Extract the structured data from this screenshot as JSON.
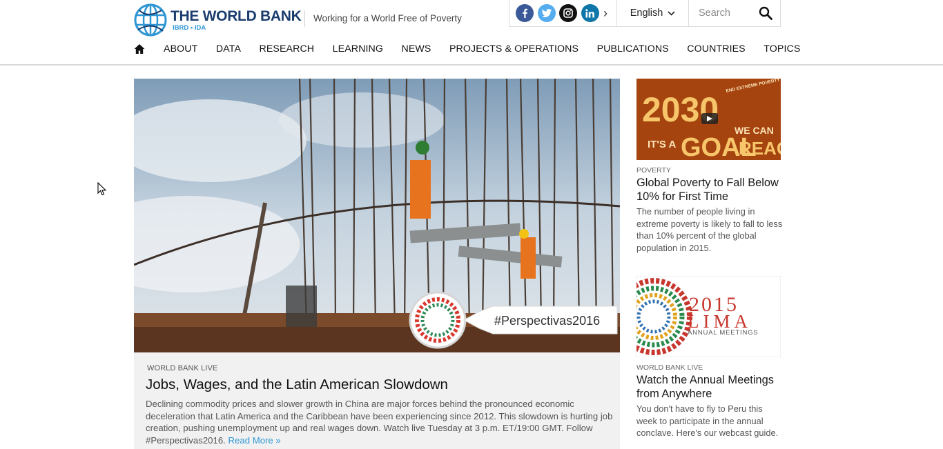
{
  "header": {
    "logo_title": "THE WORLD BANK",
    "logo_sub": "IBRD • IDA",
    "tagline": "Working for a World Free of Poverty",
    "language": "English",
    "search_placeholder": "Search",
    "socials": [
      "facebook-icon",
      "twitter-icon",
      "instagram-icon",
      "linkedin-icon"
    ]
  },
  "nav": {
    "items": [
      "ABOUT",
      "DATA",
      "RESEARCH",
      "LEARNING",
      "NEWS",
      "PROJECTS & OPERATIONS",
      "PUBLICATIONS",
      "COUNTRIES",
      "TOPICS"
    ]
  },
  "feature": {
    "hashtag": "#Perspectivas2016",
    "kicker": "WORLD BANK LIVE",
    "title": "Jobs, Wages, and the Latin American Slowdown",
    "description": "Declining commodity prices and slower growth in China are major forces behind the pronounced economic deceleration that Latin America and the Caribbean have been experiencing since 2012. This slowdown is hurting job creation, pushing unemployment up and real wages down. Watch live Tuesday at 3 p.m. ET/19:00 GMT. Follow #Perspectivas2016.",
    "read_more": "Read More »"
  },
  "sidebar": [
    {
      "thumb_big": "2030",
      "thumb_small": "IT'S A",
      "thumb_goal": "GOAL",
      "thumb_we_can": "WE CAN",
      "thumb_reach": "REACH",
      "thumb_tag": "END EXTREME POVERTY SHARED PROSPERITY",
      "kicker": "POVERTY",
      "title": "Global Poverty to Fall Below 10% for First Time",
      "description": "The number of people living in extreme poverty is likely to fall to less than 10% percent of the global population in 2015."
    },
    {
      "thumb_year": "2015",
      "thumb_city": "LIMA",
      "thumb_event": "ANNUAL MEETINGS",
      "kicker": "WORLD BANK LIVE",
      "title": "Watch the Annual Meetings from Anywhere",
      "description": "You don't have to fly to Peru this week to participate in the annual conclave. Here's our webcast guide."
    }
  ],
  "colors": {
    "brand_navy": "#1b3d6e",
    "brand_blue": "#2f96d4",
    "link": "#2f96d4"
  }
}
